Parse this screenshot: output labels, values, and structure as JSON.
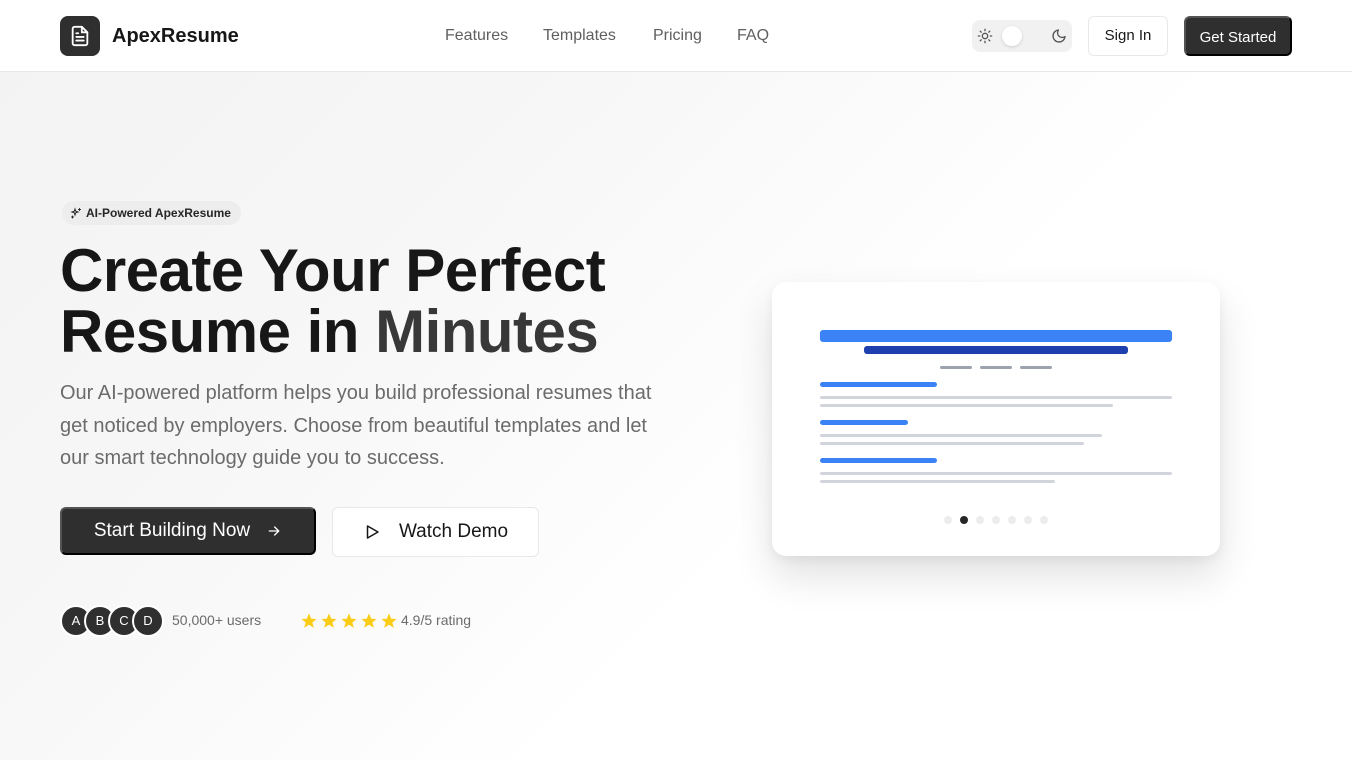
{
  "brand": {
    "name": "ApexResume",
    "logo_icon": "document-icon"
  },
  "nav": {
    "links": [
      {
        "label": "Features"
      },
      {
        "label": "Templates"
      },
      {
        "label": "Pricing"
      },
      {
        "label": "FAQ"
      }
    ]
  },
  "header": {
    "theme_toggle": {
      "light_icon": "sun-icon",
      "dark_icon": "moon-icon",
      "mode": "light"
    },
    "sign_in_label": "Sign In",
    "get_started_label": "Get Started"
  },
  "hero": {
    "badge": "AI-Powered ApexResume",
    "title_line1": "Create Your Perfect",
    "title_line2_main": "Resume in ",
    "title_line2_accent": "Minutes",
    "subtitle": "Our AI-powered platform helps you build professional resumes that get noticed by employers. Choose from beautiful templates and let our smart technology guide you to success.",
    "primary_cta": "Start Building Now",
    "secondary_cta": "Watch Demo"
  },
  "social_proof": {
    "avatars": [
      "A",
      "B",
      "C",
      "D"
    ],
    "users_text": "50,000+ users",
    "stars": 5,
    "rating_text": "4.9/5 rating"
  },
  "preview": {
    "carousel_total": 7,
    "carousel_active_index": 1
  },
  "colors": {
    "primary_dark": "#2f2f2f",
    "accent_blue": "#3b82f6",
    "deep_blue": "#1e40af",
    "star_yellow": "#facc15"
  }
}
